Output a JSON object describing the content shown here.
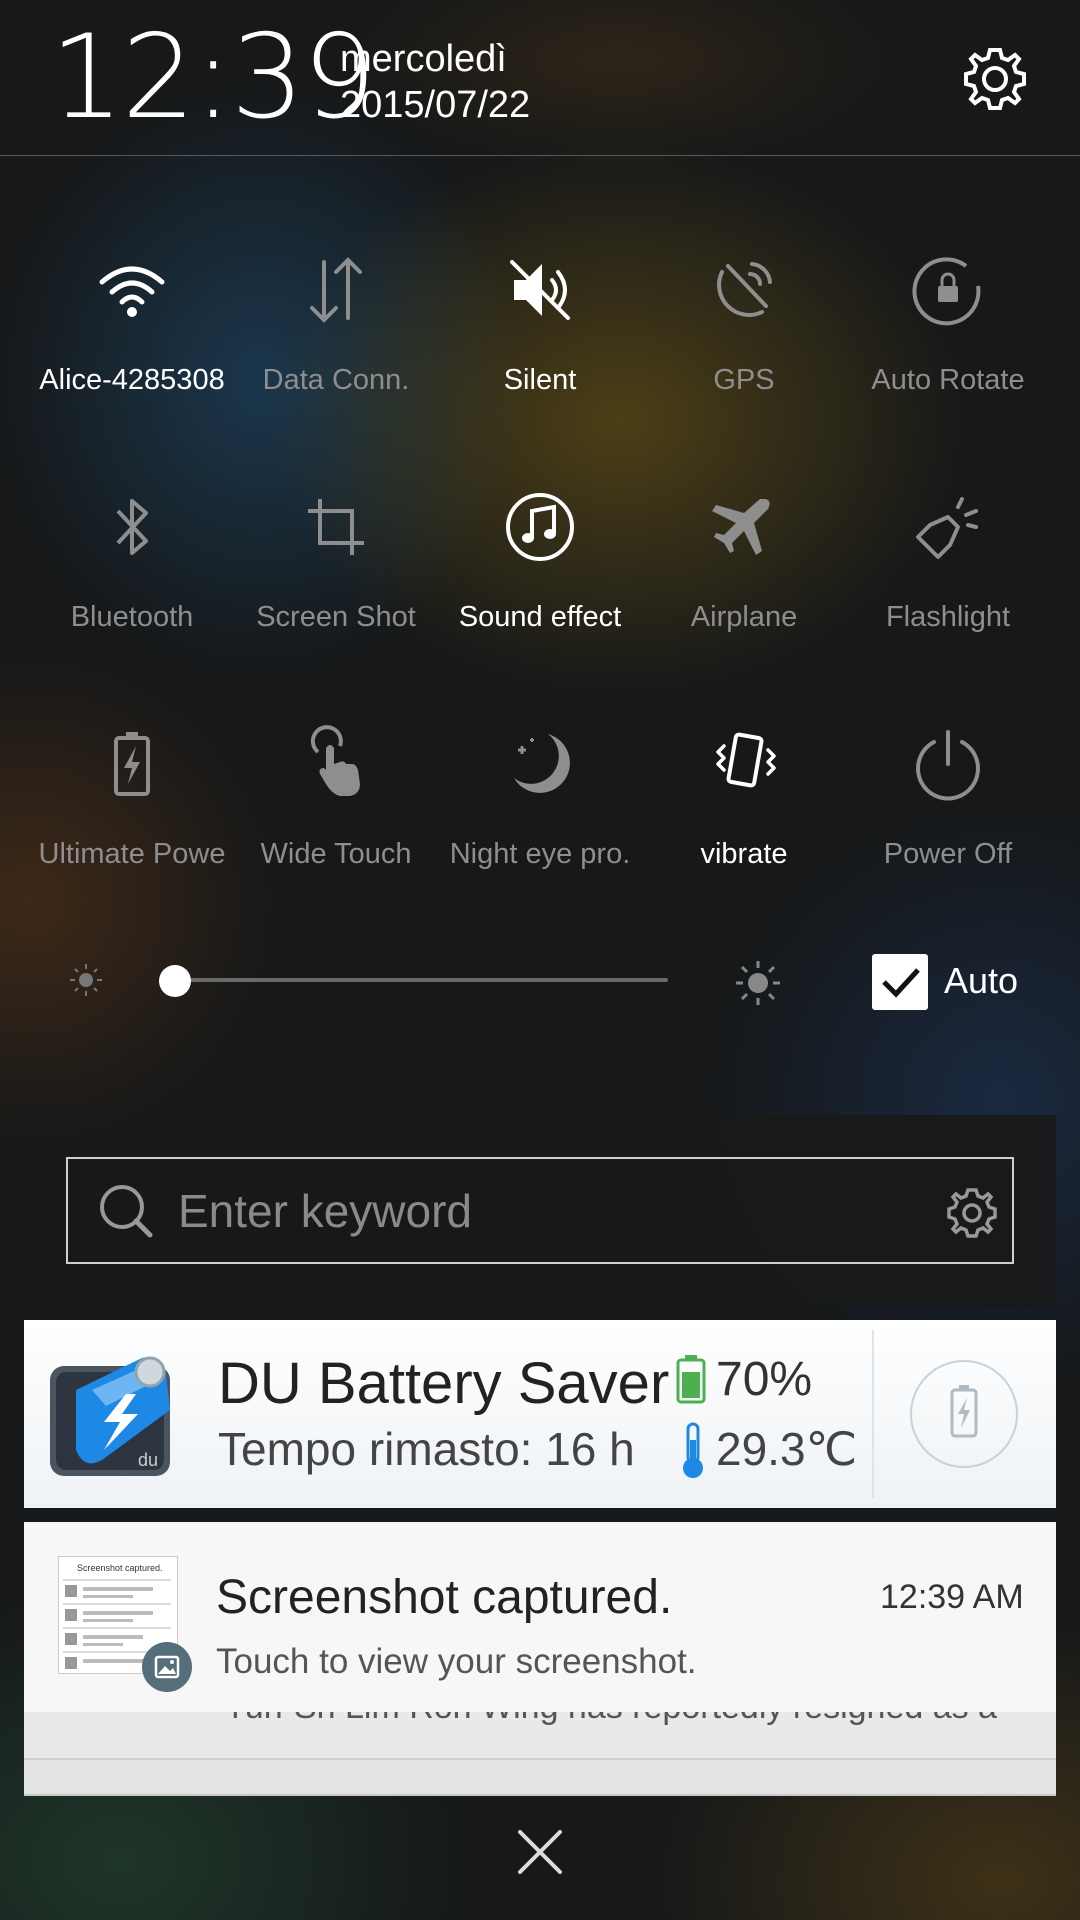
{
  "header": {
    "time": "12:39",
    "weekday": "mercoledì",
    "date": "2015/07/22"
  },
  "tiles": [
    {
      "label": "Alice-4285308",
      "icon": "wifi-icon",
      "active": true
    },
    {
      "label": "Data Conn.",
      "icon": "data-connection-icon",
      "active": false
    },
    {
      "label": "Silent",
      "icon": "silent-icon",
      "active": true
    },
    {
      "label": "GPS",
      "icon": "gps-icon",
      "active": false
    },
    {
      "label": "Auto Rotate",
      "icon": "auto-rotate-icon",
      "active": false
    },
    {
      "label": "Bluetooth",
      "icon": "bluetooth-icon",
      "active": false
    },
    {
      "label": "Screen Shot",
      "icon": "screenshot-icon",
      "active": false
    },
    {
      "label": "Sound effect",
      "icon": "sound-effect-icon",
      "active": true
    },
    {
      "label": "Airplane",
      "icon": "airplane-icon",
      "active": false
    },
    {
      "label": "Flashlight",
      "icon": "flashlight-icon",
      "active": false
    },
    {
      "label": "Ultimate Powe",
      "icon": "ultimate-power-icon",
      "active": false
    },
    {
      "label": "Wide Touch",
      "icon": "wide-touch-icon",
      "active": false
    },
    {
      "label": "Night eye pro.",
      "icon": "night-eye-icon",
      "active": false
    },
    {
      "label": "vibrate",
      "icon": "vibrate-icon",
      "active": true
    },
    {
      "label": "Power Off",
      "icon": "power-off-icon",
      "active": false
    }
  ],
  "brightness": {
    "level": 0.0,
    "auto_label": "Auto",
    "auto_checked": true
  },
  "search": {
    "placeholder": "Enter keyword"
  },
  "du_battery": {
    "title": "DU Battery Saver",
    "percent": "70%",
    "remaining": "Tempo rimasto: 16 h",
    "temperature": "29.3℃",
    "icon_text": "du"
  },
  "screenshot_notification": {
    "title": "Screenshot captured.",
    "time": "12:39 AM",
    "subtitle": "Touch to view your screenshot.",
    "thumb_text": "Screenshot captured."
  },
  "stacked_peek": "Yun-Sh Lim Roh Wing has reportedly resigned as a",
  "colors": {
    "tile_active": "#ffffff",
    "tile_inactive": "#8e8e8e",
    "battery_green": "#4caf50",
    "thermometer_blue": "#1e88e5"
  }
}
